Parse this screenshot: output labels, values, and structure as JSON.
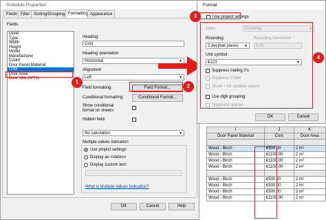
{
  "schedule_dialog": {
    "title": "Schedule Properties",
    "tabs": [
      "Fields",
      "Filter",
      "Sorting/Grouping",
      "Formatting",
      "Appearance"
    ],
    "active_tab": "Formatting",
    "fields_label": "Fields:",
    "fields": [
      "Level",
      "Type",
      "Width",
      "Height",
      "Model",
      "Manufacturer",
      "Count",
      "Door Panel Material",
      "Cost",
      "Door Area",
      "Door size (W*H)"
    ],
    "selected_field": "Cost",
    "heading_label": "Heading:",
    "heading_value": "Cost",
    "heading_orientation_label": "Heading orientation:",
    "heading_orientation_value": "Horizontal",
    "alignment_label": "Alignment:",
    "alignment_value": "Left",
    "field_formatting_label": "Field formatting:",
    "field_format_button": "Field Format...",
    "conditional_formatting_label": "Conditional formatting:",
    "conditional_format_button": "Conditional Format...",
    "show_conditional_label": "Show conditional format on sheets:",
    "hidden_field_label": "Hidden field:",
    "calculation_value": "No calculation",
    "multiple_values_label": "Multiple values indication",
    "radio_project": "Use project settings",
    "radio_display_as": "Display as <varies>",
    "radio_custom": "Display custom text:",
    "help_link": "What is Multiple Values Indication?",
    "ok": "OK",
    "cancel": "Cancel",
    "help": "Help"
  },
  "format_dialog": {
    "title": "Format",
    "use_project_settings": "Use project settings",
    "units_label": "Units:",
    "units_value": "Currency",
    "rounding_label": "Rounding:",
    "rounding_value": "2 decimal places",
    "rounding_increment_label": "Rounding increment:",
    "rounding_increment_value": "0.01",
    "unit_symbol_label": "Unit symbol:",
    "unit_symbol_value": "€123",
    "suppress_trailing": "Suppress trailing 0's",
    "suppress_zero_feet": "Suppress 0 feet",
    "show_plus": "Show + for positive values",
    "use_digit_grouping": "Use digit grouping",
    "suppress_spaces": "Suppress spaces",
    "ok": "OK",
    "cancel": "Cancel"
  },
  "callouts": [
    "1",
    "2",
    "3",
    "4"
  ],
  "table": {
    "col_letters": [
      "I",
      "J",
      "K"
    ],
    "headers": [
      "Door Panel Material",
      "Cost",
      "Door Area"
    ],
    "rows": [
      {
        "group": true
      },
      {
        "material": "Wood - Birch",
        "cost": "€500.00",
        "area": "2 m²",
        "selected": true
      },
      {
        "material": "Wood - Birch",
        "cost": "€1100.00",
        "area": "2 m²"
      },
      {
        "material": "Wood - Birch",
        "cost": "€1100.00",
        "area": "2 m²"
      },
      {
        "material": "Wood - Birch",
        "cost": "€1100.00",
        "area": "2 m²"
      },
      {
        "group": true
      },
      {
        "material": "Wood - Birch",
        "cost": "€500.00",
        "area": "2 m²"
      },
      {
        "material": "Wood - Birch",
        "cost": "€500.00",
        "area": "2 m²"
      },
      {
        "material": "Wood - Birch",
        "cost": "€500.00",
        "area": "2 m²"
      },
      {
        "material": "Wood - Birch",
        "cost": "€1100.00",
        "area": "2 m²"
      }
    ]
  },
  "colors": {
    "accent": "#0078d7",
    "callout": "#e21b1b"
  }
}
